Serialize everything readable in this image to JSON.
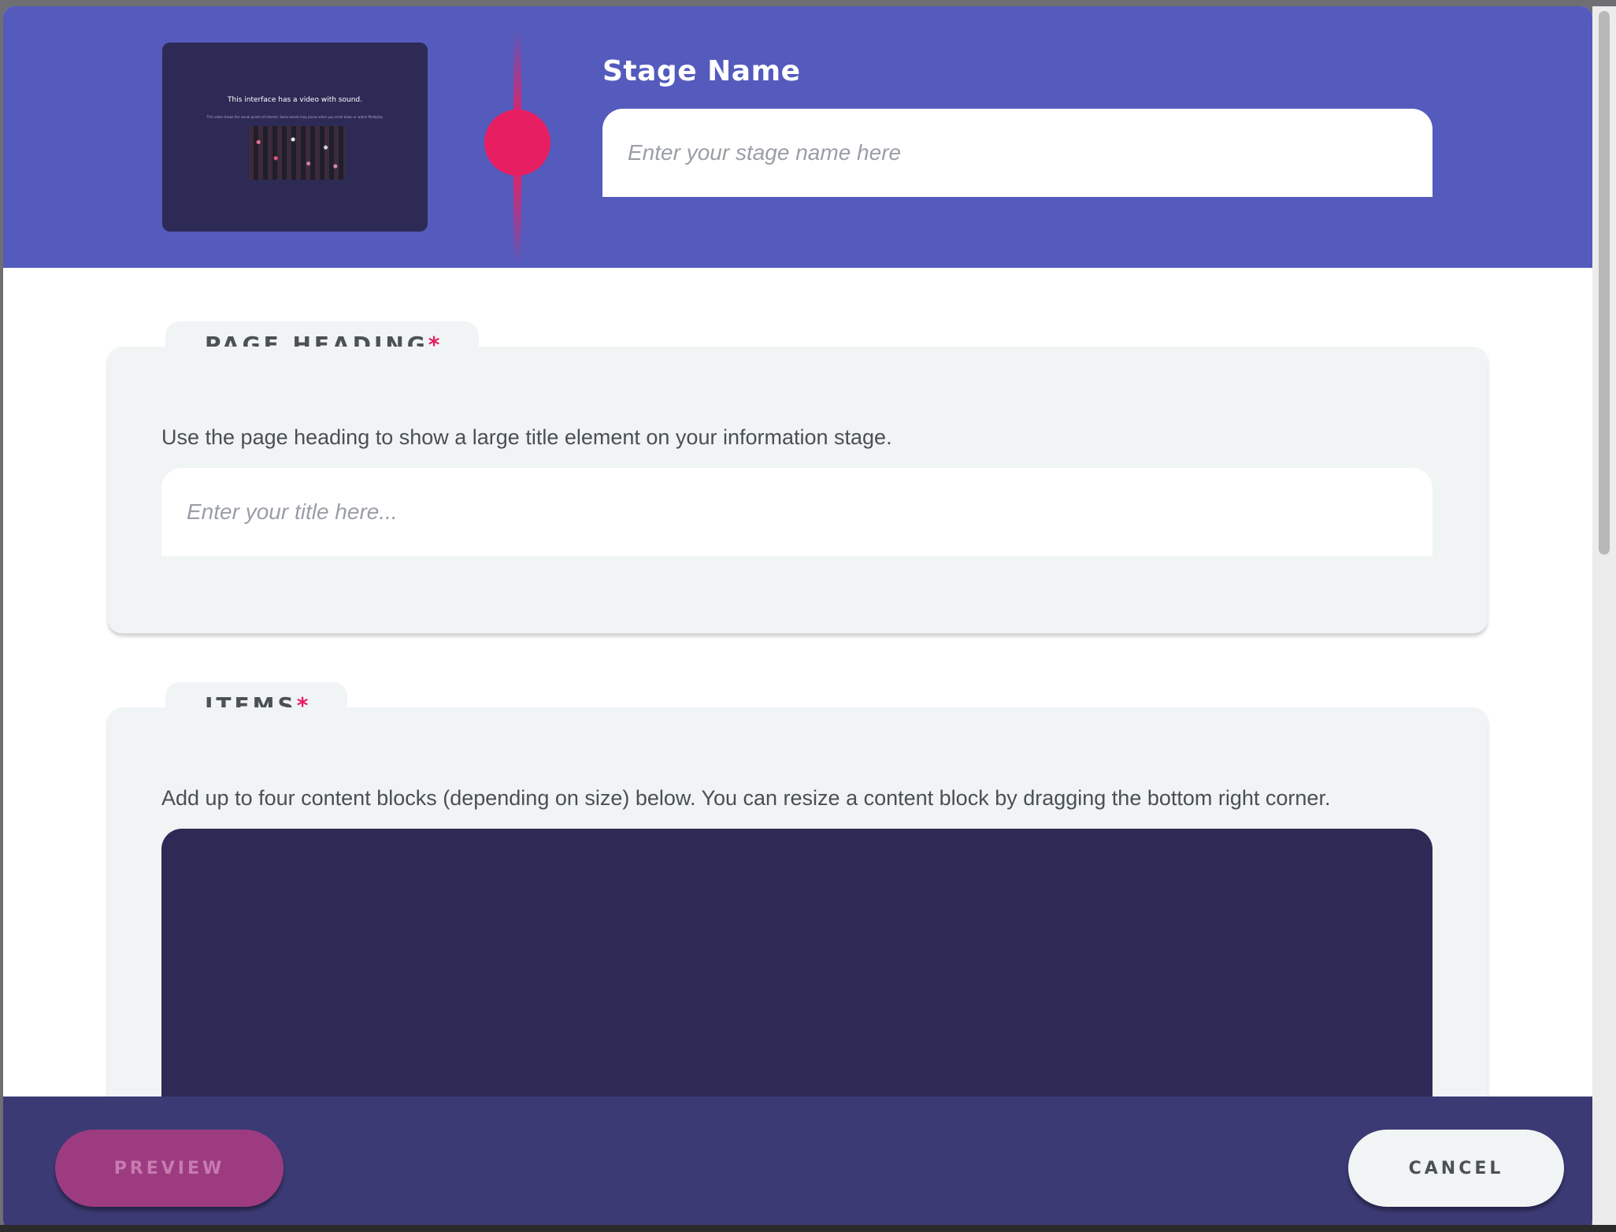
{
  "header": {
    "thumbnail": {
      "title": "This interface has a video with sound.",
      "subtitle": "This video shows the visual points of interest. Some words may pause when you scroll down or watch Multiplay."
    },
    "stage_name_label": "Stage Name",
    "stage_name_placeholder": "Enter your stage name here",
    "stage_name_value": ""
  },
  "page_heading": {
    "tab_label": "PAGE HEADING",
    "required_mark": "*",
    "description": "Use the page heading to show a large title element on your information stage.",
    "title_placeholder": "Enter your title here...",
    "title_value": ""
  },
  "items": {
    "tab_label": "ITEMS",
    "required_mark": "*",
    "description": "Add up to four content blocks (depending on size) below. You can resize a content block by dragging the bottom right corner."
  },
  "footer": {
    "preview_label": "PREVIEW",
    "cancel_label": "CANCEL"
  },
  "colors": {
    "header_bg": "#545bbd",
    "accent_pink": "#e81e62",
    "canvas_dark": "#2d2a56",
    "footer_bg": "#3b3a74",
    "preview_button": "#9d3b81",
    "section_bg": "#f1f4f5"
  }
}
